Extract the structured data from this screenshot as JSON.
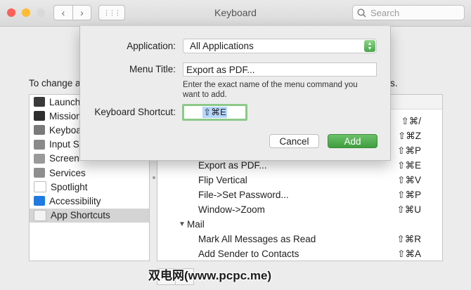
{
  "window": {
    "title": "Keyboard",
    "back_glyph": "‹",
    "forward_glyph": "›",
    "grid_glyph": "⋮⋮⋮",
    "search_placeholder": "Search"
  },
  "colors": {
    "close": "#fe5f57",
    "minimize": "#febc2e",
    "zoom": "#d9d9d9",
    "accent_green": "#4aa64a",
    "selection": "#d4d4d4"
  },
  "background": {
    "desc_left": "To change a",
    "desc_right": "s.",
    "categories": [
      {
        "label": "Launch",
        "icon": "launchpad-icon",
        "color": "#3a3a3a"
      },
      {
        "label": "Mission",
        "icon": "mission-control-icon",
        "color": "#2e2e2e"
      },
      {
        "label": "Keyboa",
        "icon": "keyboard-icon",
        "color": "#7a7a7a"
      },
      {
        "label": "Input S",
        "icon": "input-sources-icon",
        "color": "#8a8a8a"
      },
      {
        "label": "Screen",
        "icon": "screenshot-icon",
        "color": "#9a9a9a"
      },
      {
        "label": "Services",
        "icon": "gear-icon",
        "color": "#8e8e8e"
      },
      {
        "label": "Spotlight",
        "icon": "spotlight-icon",
        "color": "#ffffff"
      },
      {
        "label": "Accessibility",
        "icon": "accessibility-icon",
        "color": "#1f7ae0"
      },
      {
        "label": "App Shortcuts",
        "icon": "app-shortcuts-icon",
        "color": "#f3f3f3"
      }
    ],
    "shortcuts": [
      {
        "name": "",
        "key": "⇧⌘/"
      },
      {
        "name": "",
        "key": "⇧⌘Z"
      },
      {
        "name": "",
        "key": "⇧⌘P"
      },
      {
        "name": "Export as PDF...",
        "key": "⇧⌘E"
      },
      {
        "name": "Flip Vertical",
        "key": "⇧⌘V"
      },
      {
        "name": "File->Set Password...",
        "key": "⇧⌘P"
      },
      {
        "name": "Window->Zoom",
        "key": "⇧⌘U"
      },
      {
        "name": "Mail",
        "key": "",
        "group": true
      },
      {
        "name": "Mark All Messages as Read",
        "key": "⇧⌘R"
      },
      {
        "name": "Add Sender to Contacts",
        "key": "⇧⌘A"
      }
    ]
  },
  "dialog": {
    "application_label": "Application:",
    "application_value": "All Applications",
    "menu_title_label": "Menu Title:",
    "menu_title_value": "Export as PDF...",
    "hint": "Enter the exact name of the menu command you want to add.",
    "shortcut_label": "Keyboard Shortcut:",
    "shortcut_value": "⇧⌘E",
    "cancel_label": "Cancel",
    "add_label": "Add"
  },
  "watermark": "双电网(www.pcpc.me)"
}
